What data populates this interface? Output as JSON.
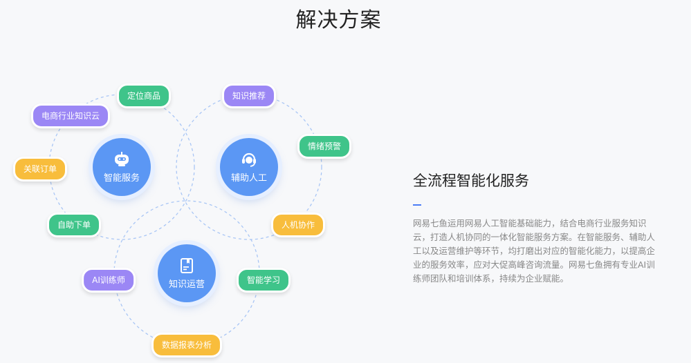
{
  "section_title": "解决方案",
  "hubs": {
    "smart_service": "智能服务",
    "assist_human": "辅助人工",
    "knowledge_ops": "知识运营"
  },
  "tags": {
    "locate_product": "定位商品",
    "ecommerce_cloud": "电商行业知识云",
    "related_order": "关联订单",
    "auto_order": "自助下单",
    "knowledge_recommend": "知识推荐",
    "emotion_warning": "情绪预警",
    "human_machine": "人机协作",
    "ai_trainer": "AI训练师",
    "smart_learning": "智能学习",
    "report_analysis": "数据报表分析"
  },
  "colors": {
    "hub": "#5b97f4",
    "green": "#3fc48a",
    "purple": "#9b87f5",
    "yellow": "#f8bd3c",
    "accent": "#4a7cf6"
  },
  "info": {
    "title": "全流程智能化服务",
    "description": "网易七鱼运用网易人工智能基础能力，结合电商行业服务知识云，打造人机协同的一体化智能服务方案。在智能服务、辅助人工以及运营维护等环节，均打磨出对应的智能化能力，以提高企业的服务效率，应对大促高峰咨询流量。网易七鱼拥有专业AI训练师团队和培训体系，持续为企业赋能。"
  }
}
